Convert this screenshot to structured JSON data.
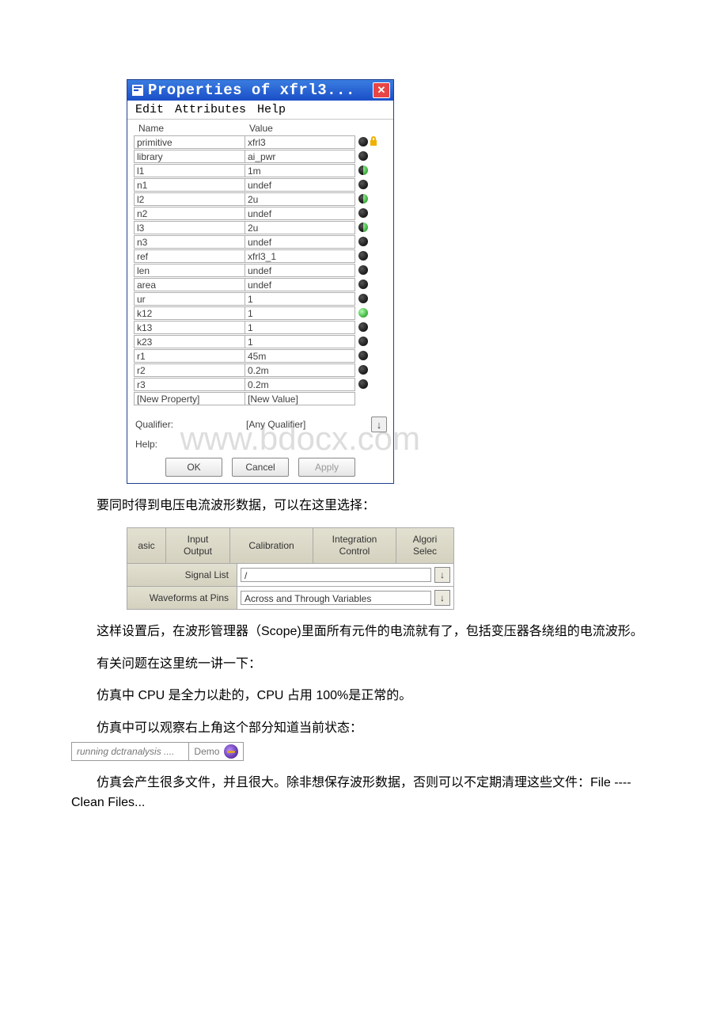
{
  "dialog": {
    "title": "Properties of xfrl3...",
    "menu": [
      "Edit",
      "Attributes",
      "Help"
    ],
    "columns": {
      "name": "Name",
      "value": "Value"
    },
    "rows": [
      {
        "name": "primitive",
        "value": "xfrl3",
        "dot": "bk",
        "lock": true
      },
      {
        "name": "library",
        "value": "ai_pwr",
        "dot": "bk"
      },
      {
        "name": "l1",
        "value": "1m",
        "dot": "hf"
      },
      {
        "name": "n1",
        "value": "undef",
        "dot": "bk"
      },
      {
        "name": "l2",
        "value": "2u",
        "dot": "hf"
      },
      {
        "name": "n2",
        "value": "undef",
        "dot": "bk"
      },
      {
        "name": "l3",
        "value": "2u",
        "dot": "hf"
      },
      {
        "name": "n3",
        "value": "undef",
        "dot": "bk"
      },
      {
        "name": "ref",
        "value": "xfrl3_1",
        "dot": "bk"
      },
      {
        "name": "len",
        "value": "undef",
        "dot": "bk"
      },
      {
        "name": "area",
        "value": "undef",
        "dot": "bk"
      },
      {
        "name": "ur",
        "value": "1",
        "dot": "bk"
      },
      {
        "name": "k12",
        "value": "1",
        "dot": "gr"
      },
      {
        "name": "k13",
        "value": "1",
        "dot": "bk"
      },
      {
        "name": "k23",
        "value": "1",
        "dot": "bk"
      },
      {
        "name": "r1",
        "value": "45m",
        "dot": "bk"
      },
      {
        "name": "r2",
        "value": "0.2m",
        "dot": "bk"
      },
      {
        "name": "r3",
        "value": "0.2m",
        "dot": "bk"
      },
      {
        "name": "[New Property]",
        "value": "[New Value]"
      }
    ],
    "qualifier_label": "Qualifier:",
    "qualifier_value": "[Any Qualifier]",
    "help_label": "Help:",
    "buttons": {
      "ok": "OK",
      "cancel": "Cancel",
      "apply": "Apply"
    }
  },
  "watermark": "www.bdocx.com",
  "p1": "要同时得到电压电流波形数据，可以在这里选择：",
  "tabs": {
    "t0": "asic",
    "t1a": "Input",
    "t1b": "Output",
    "t2": "Calibration",
    "t3a": "Integration",
    "t3b": "Control",
    "t4a": "Algori",
    "t4b": "Selec",
    "signal_label": "Signal List",
    "signal_value": "/",
    "wave_label": "Waveforms at Pins",
    "wave_value": "Across and Through Variables"
  },
  "p2": "这样设置后，在波形管理器（Scope)里面所有元件的电流就有了，包括变压器各绕组的电流波形。",
  "p3": "有关问题在这里统一讲一下：",
  "p4": "仿真中 CPU 是全力以赴的，CPU 占用 100%是正常的。",
  "p5": "仿真中可以观察右上角这个部分知道当前状态：",
  "status_text": "running dctranalysis ....",
  "status_demo": "Demo",
  "p6": "仿真会产生很多文件，并且很大。除非想保存波形数据，否则可以不定期清理这些文件：File ----Clean Files..."
}
